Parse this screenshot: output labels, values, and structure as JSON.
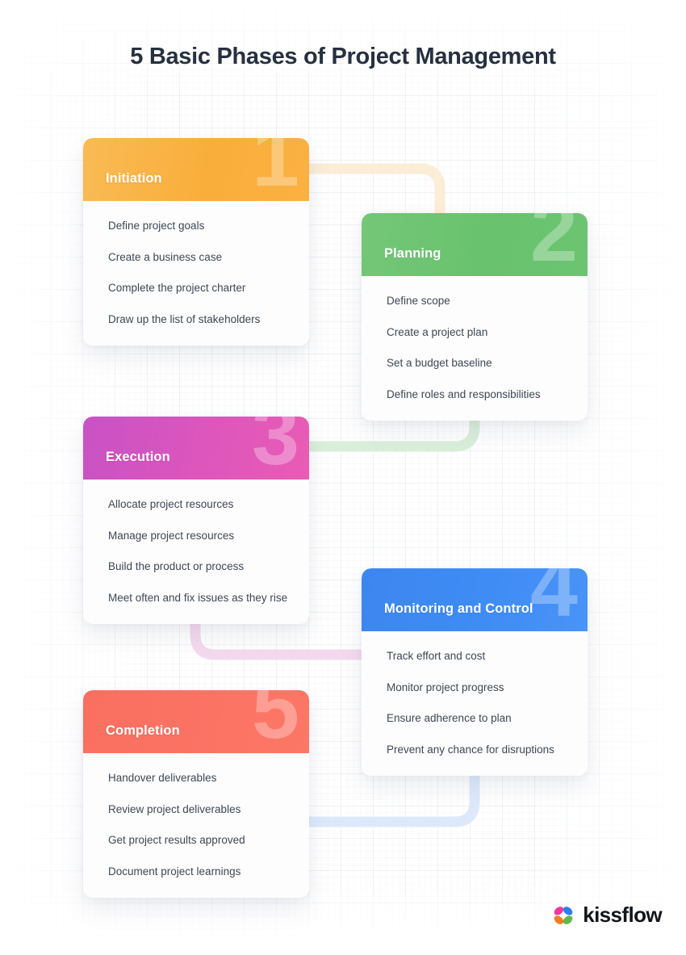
{
  "page": {
    "title": "5 Basic Phases of Project Management",
    "background_color": "#ffffff",
    "title_color": "#26303f"
  },
  "phases": [
    {
      "number": "1",
      "name": "Initiation",
      "color": "#f9ae3b",
      "theme": "orange",
      "tasks": [
        "Define project goals",
        "Create a business case",
        "Complete the project charter",
        "Draw up the list of stakeholders"
      ]
    },
    {
      "number": "2",
      "name": "Planning",
      "color": "#69c26e",
      "theme": "green",
      "tasks": [
        "Define scope",
        "Create a project plan",
        "Set a budget baseline",
        "Define roles and responsibilities"
      ]
    },
    {
      "number": "3",
      "name": "Execution",
      "color": "#dd56bc",
      "theme": "pink",
      "tasks": [
        "Allocate project resources",
        "Manage project resources",
        "Build the product or process",
        "Meet often and fix issues as they rise"
      ]
    },
    {
      "number": "4",
      "name": "Monitoring and Control",
      "color": "#3f8cf5",
      "theme": "blue",
      "tasks": [
        "Track effort and cost",
        "Monitor project progress",
        "Ensure adherence to plan",
        "Prevent any chance for disruptions"
      ]
    },
    {
      "number": "5",
      "name": "Completion",
      "color": "#fb7364",
      "theme": "red",
      "tasks": [
        "Handover deliverables",
        "Review project deliverables",
        "Get project results approved",
        "Document project learnings"
      ]
    }
  ],
  "connectors": [
    {
      "from": "1",
      "to": "2",
      "color": "#fbedd6"
    },
    {
      "from": "2",
      "to": "3",
      "color": "#d9efd9"
    },
    {
      "from": "3",
      "to": "4",
      "color": "#f4d9ee"
    },
    {
      "from": "4",
      "to": "5",
      "color": "#dde9fb"
    }
  ],
  "logo": {
    "text": "kissflow",
    "icon": "kissflow-butterfly-icon",
    "petal_colors": {
      "top_left": "#ec3aa0",
      "top_right": "#2d7ff0",
      "bottom_left": "#f57c20",
      "bottom_right": "#5cb947"
    }
  }
}
